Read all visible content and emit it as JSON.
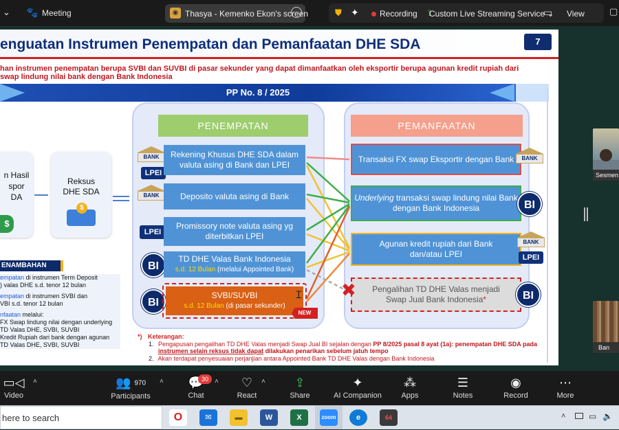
{
  "topbar": {
    "meeting_label": "Meeting",
    "share_label": "Thasya - Kemenko Ekon's screen",
    "recording_label": "Recording",
    "streaming_label": "Custom Live Streaming Service",
    "view_label": "View"
  },
  "slide": {
    "title": "enguatan Instrumen Penempatan dan Pemanfaatan DHE SDA",
    "page_number": "7",
    "subtitle_line1": "han instrumen penempatan berupa SVBI dan SUVBI di pasar sekunder yang dapat dimanfaatkan oleh eksportir berupa agunan kredit rupiah dari",
    "subtitle_line2": " swap lindung nilai bank dengan Bank Indonesia",
    "pp_label": "PP No. 8 / 2025",
    "left_box1": "n Hasil\nspor\nDA",
    "left_box2": "Reksus\nDHE SDA",
    "penempatan_header": "PENEMPATAN",
    "pemanfaatan_header": "PEMANFAATAN",
    "penempatan_items": [
      "Rekening Khusus DHE SDA dalam valuta asing di Bank dan LPEI",
      "Deposito valuta asing di Bank",
      "Promissory note valuta asing yg diterbitkan LPEI",
      "TD DHE Valas Bank Indonesia",
      "SVBI/SUVBI"
    ],
    "td_sub_yellow": "s.d. 12 Bulan",
    "td_sub_white": " (melalui Appointed Bank)",
    "svbi_sub_yellow": "s.d. 12 Bulan",
    "svbi_sub_white": " (di pasar sekunder)",
    "new_badge": "NEW",
    "pemanfaatan_items": {
      "fx": "Transaksi FX swap Eksportir dengan Bank",
      "underlying_italic": "Underlying",
      "underlying_rest": " transaksi swap lindung nilai Bank dengan Bank Indonesia",
      "agunan": "Agunan kredit rupiah dari Bank dan/atau LPEI",
      "pengalihan": "Pengalihan TD DHE Valas menjadi Swap Jual Bank Indonesia",
      "asterisk": "*"
    },
    "bank_label": "BANK",
    "lpei_label": "LPEI",
    "bi_label": "BI",
    "penambahan_header": "ENAMBAHAN",
    "left_list": [
      {
        "hl": "empatan",
        "rest": " di instrumen Term Deposit"
      },
      {
        "hl": "",
        "rest": ") valas DHE s.d. tenor 12 bulan"
      },
      {
        "hl": "empatan",
        "rest": " di instrumen SVBI dan"
      },
      {
        "hl": "",
        "rest": "VBI s.d. tenor 12 bulan"
      },
      {
        "hl": "nfaatan",
        "rest": " melalui:"
      },
      {
        "hl": "",
        "rest": "FX Swap lindung nilai dengan underlying"
      },
      {
        "hl": "",
        "rest": "TD Valas DHE, SVBI, SUVBI"
      },
      {
        "hl": "",
        "rest": "Kredit Rupiah dari bank dengan agunan"
      },
      {
        "hl": "",
        "rest": "TD Valas DHE, SVBI, SUVBI"
      }
    ],
    "notes_title": "Keterangan:",
    "notes_star": "*)",
    "note1_a": "Pengapusan pengalihan TD DHE Valas menjadi Swap Jual BI sejalan dengan ",
    "note1_b": "PP 8/2025 pasal 8 ayat (1a): penempatan DHE SDA pada",
    "note1_c": "instrumen selain reksus tidak dapat",
    "note1_d": " dilakukan penarikan sebelum jatuh tempo",
    "note2": "Akan terdapat penyesuaian perjanjian antara Appointed Bank TD DHE Valas dengan Bank Indonesia",
    "num1": "1.",
    "num2": "2."
  },
  "participants_panel": {
    "tile1_label": "Sesmen",
    "tile2_label": "Ban"
  },
  "toolbar": {
    "video": "Video",
    "participants": "Participants",
    "participants_count": "970",
    "chat": "Chat",
    "chat_badge": "30",
    "react": "React",
    "share": "Share",
    "ai": "AI Companion",
    "apps": "Apps",
    "notes": "Notes",
    "record": "Record",
    "more": "More"
  },
  "taskbar": {
    "search_text": "here to search",
    "badge": "64"
  },
  "colors": {
    "accent_blue": "#4f93d6",
    "navy": "#0d2a6b",
    "penempatan_green": "#8ec25a",
    "pemanfaatan_salmon": "#f4a08c",
    "svbi_orange": "#d96014",
    "red": "#d32020"
  }
}
